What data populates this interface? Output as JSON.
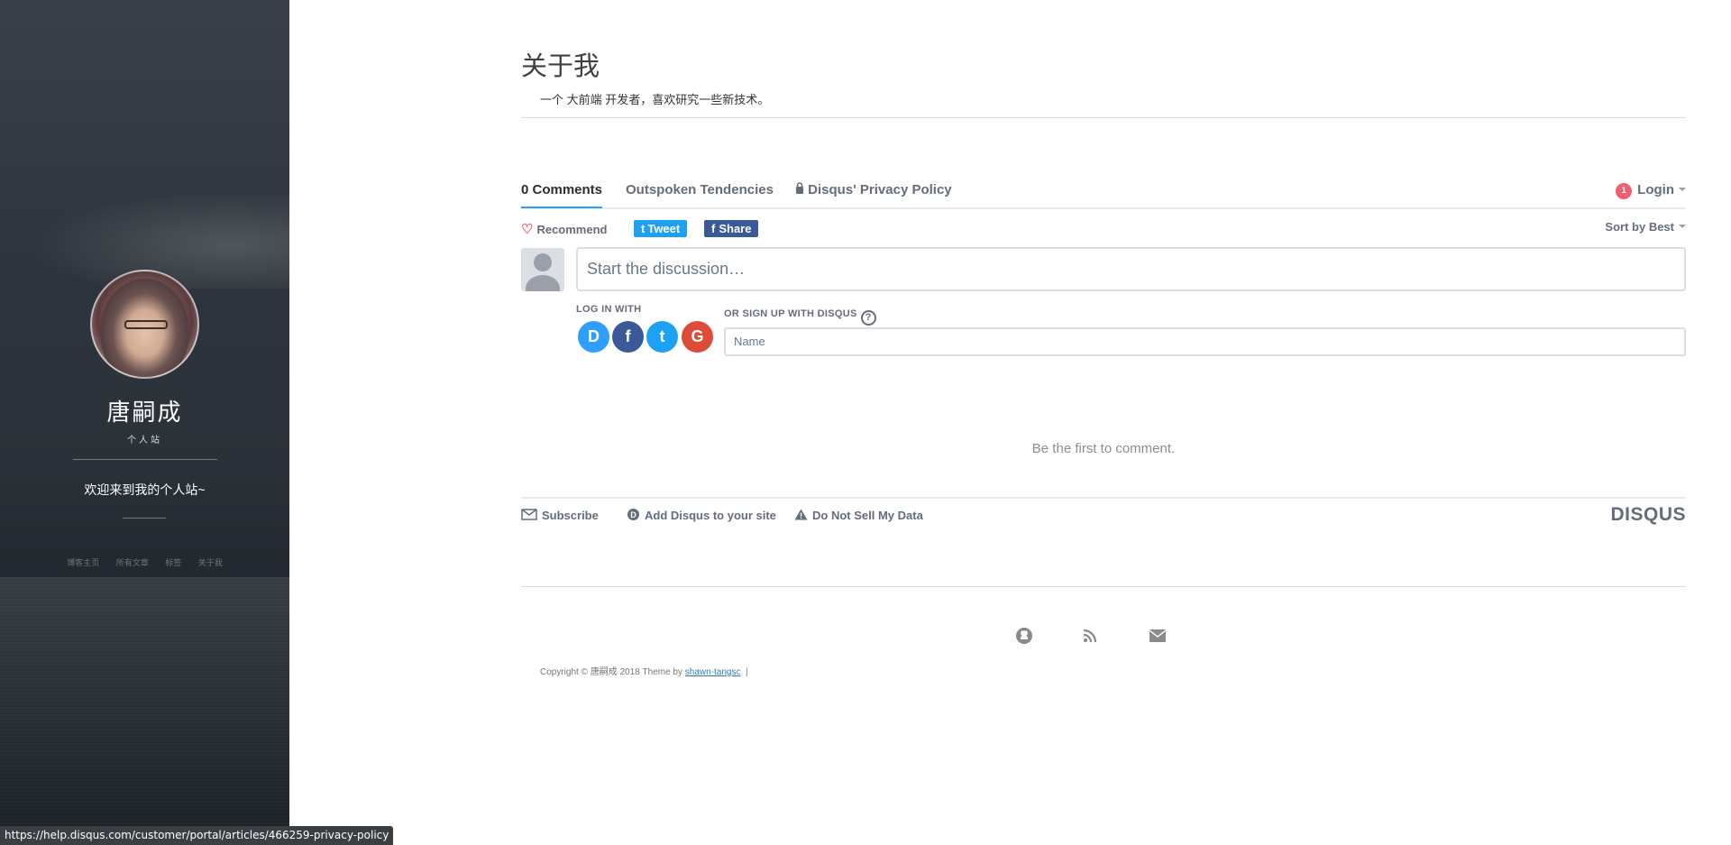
{
  "sidebar": {
    "name": "唐嗣成",
    "subtitle": "个人站",
    "welcome": "欢迎来到我的个人站~",
    "nav": [
      {
        "label": "博客主页"
      },
      {
        "label": "所有文章"
      },
      {
        "label": "标签"
      },
      {
        "label": "关于我"
      }
    ]
  },
  "page": {
    "title": "关于我",
    "description": "一个 大前端 开发者，喜欢研究一些新技术。"
  },
  "disqus": {
    "tabs": {
      "comments": "0 Comments",
      "community": "Outspoken Tendencies",
      "privacy": "Disqus' Privacy Policy"
    },
    "login": {
      "badge": "1",
      "label": "Login"
    },
    "recommend": "Recommend",
    "tweet": "Tweet",
    "share": "Share",
    "sort": "Sort by Best",
    "composer": {
      "placeholder": "Start the discussion…",
      "login_with": "LOG IN WITH",
      "signup": "OR SIGN UP WITH DISQUS",
      "name_placeholder": "Name",
      "social": [
        {
          "label": "D",
          "color": "#2e9fff"
        },
        {
          "label": "f",
          "color": "#3b5998"
        },
        {
          "label": "t",
          "color": "#1da1f2"
        },
        {
          "label": "G",
          "color": "#dd4b39"
        }
      ]
    },
    "empty": "Be the first to comment.",
    "footer": {
      "subscribe": "Subscribe",
      "add": "Add Disqus to your site",
      "dnsmd": "Do Not Sell My Data",
      "logo": "DISQUS"
    }
  },
  "footer": {
    "copyright_prefix": "Copyright © 唐嗣成 2018 Theme by ",
    "author_link": "shawn-tangsc",
    "separator": "|"
  },
  "status_bar": {
    "url": "https://help.disqus.com/customer/portal/articles/466259-privacy-policy"
  },
  "colors": {
    "accent": "#2e9fff",
    "tweet": "#1da1f2",
    "facebook": "#3b5998",
    "badge": "#f05f70"
  }
}
